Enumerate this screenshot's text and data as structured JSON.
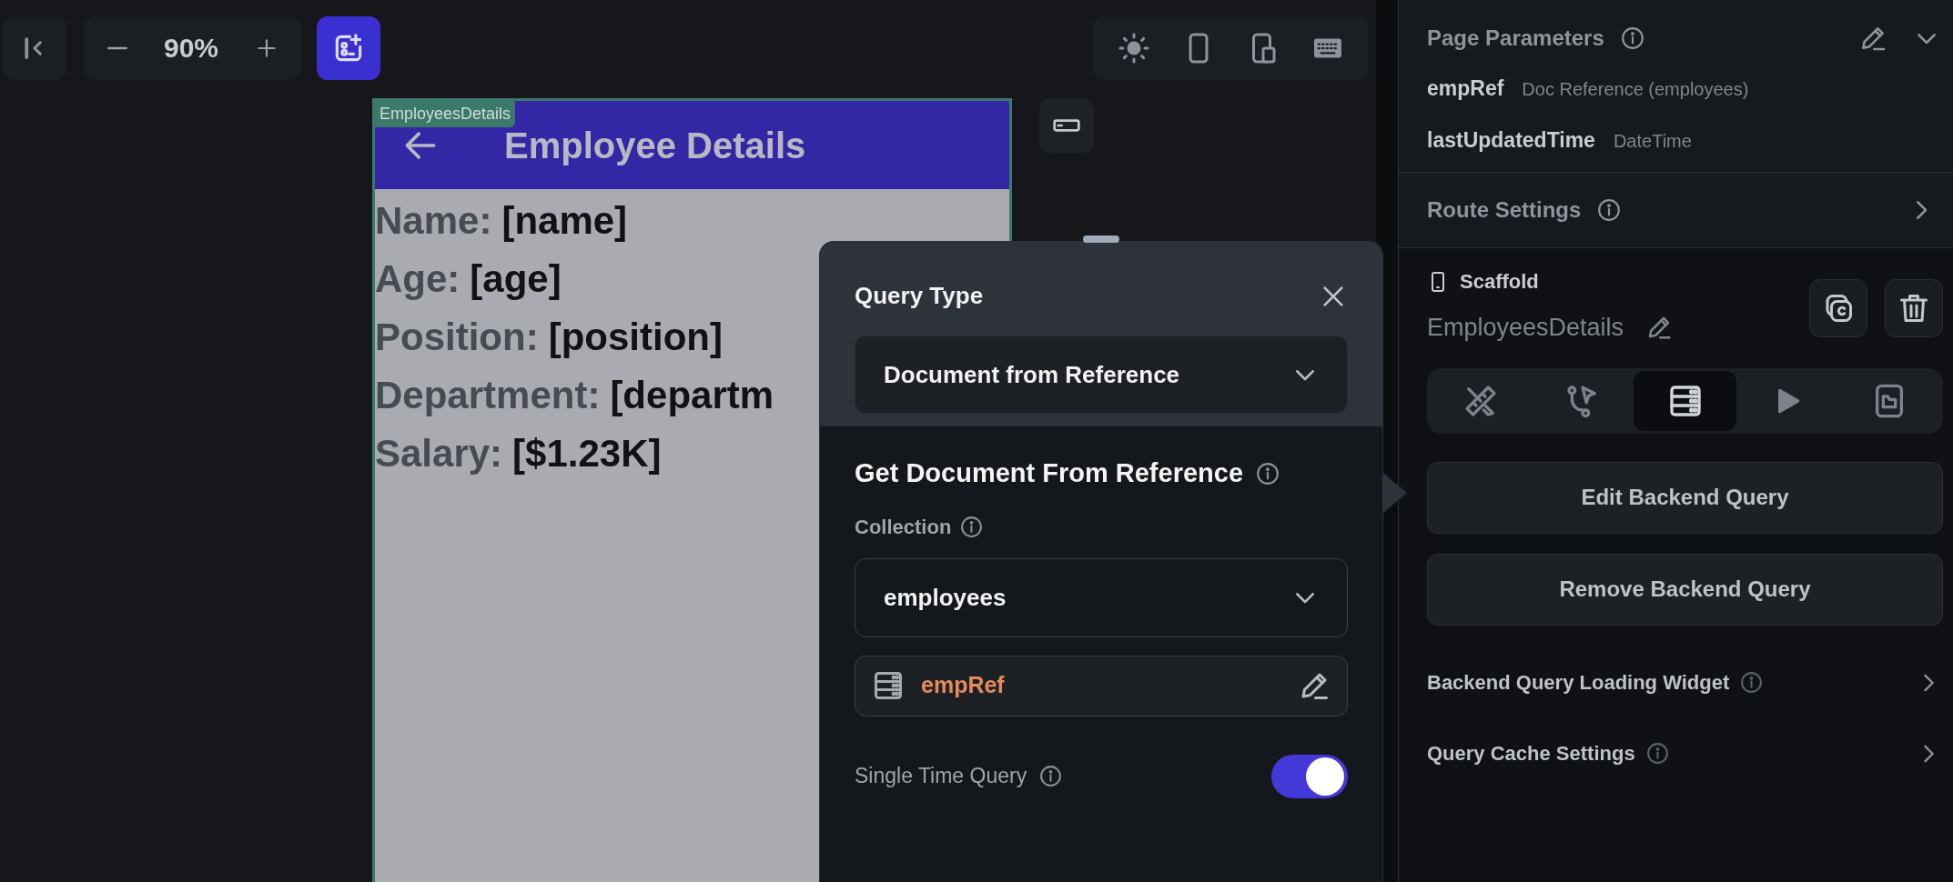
{
  "toolbar": {
    "zoom": "90%"
  },
  "canvas": {
    "page_label": "EmployeesDetails",
    "app_bar_title": "Employee Details",
    "fields": [
      {
        "label": "Name:",
        "value": "[name]"
      },
      {
        "label": "Age:",
        "value": "[age]"
      },
      {
        "label": "Position:",
        "value": "[position]"
      },
      {
        "label": "Department:",
        "value": "[departm"
      },
      {
        "label": "Salary:",
        "value": "[$1.23K]"
      }
    ]
  },
  "query_dialog": {
    "title": "Query Type",
    "query_type": "Document from Reference",
    "section_title": "Get Document From Reference",
    "collection_label": "Collection",
    "collection": "employees",
    "reference": "empRef",
    "single_time_query": {
      "label": "Single Time Query",
      "on": true
    }
  },
  "properties_panel": {
    "page_parameters": {
      "title": "Page Parameters",
      "expanded": true,
      "params": [
        {
          "name": "empRef",
          "type": "Doc Reference (employees)"
        },
        {
          "name": "lastUpdatedTime",
          "type": "DateTime"
        }
      ]
    },
    "route_settings": {
      "title": "Route Settings",
      "expanded": false
    },
    "widget": {
      "type": "Scaffold",
      "name": "EmployeesDetails"
    },
    "tabs": [
      {
        "kind": "design",
        "selected": false
      },
      {
        "kind": "actions",
        "selected": false
      },
      {
        "kind": "backend",
        "selected": true
      },
      {
        "kind": "animations",
        "selected": false
      },
      {
        "kind": "files",
        "selected": false
      }
    ],
    "buttons": [
      "Edit Backend Query",
      "Remove Backend Query"
    ],
    "rows": [
      {
        "title": "Backend Query Loading Widget",
        "expanded": false
      },
      {
        "title": "Query Cache Settings",
        "expanded": false
      }
    ]
  }
}
